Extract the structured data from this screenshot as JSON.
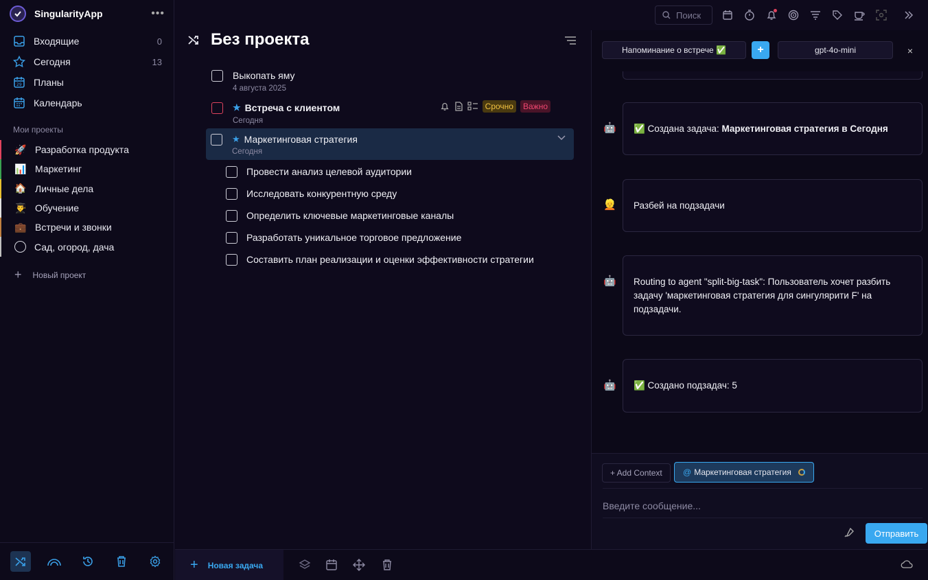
{
  "app": {
    "title": "SingularityApp",
    "menu": "•••"
  },
  "nav": [
    {
      "label": "Входящие",
      "count": "0"
    },
    {
      "label": "Сегодня",
      "count": "13"
    },
    {
      "label": "Планы",
      "count": ""
    },
    {
      "label": "Календарь",
      "count": ""
    }
  ],
  "projects_title": "Мои проекты",
  "projects": [
    {
      "emoji": "🚀",
      "label": "Разработка продукта",
      "color": "#e0435e"
    },
    {
      "emoji": "📊",
      "label": "Маркетинг",
      "color": "#3aa050"
    },
    {
      "emoji": "🏠",
      "label": "Личные дела",
      "color": "#e8c030"
    },
    {
      "emoji": "👨‍🎓",
      "label": "Обучение",
      "color": "#e0e0e0"
    },
    {
      "emoji": "💼",
      "label": "Встречи и звонки",
      "color": "#c08040"
    },
    {
      "emoji": "",
      "label": "Сад, огород, дача",
      "color": "#c0c0c0"
    }
  ],
  "new_project": "Новый проект",
  "main": {
    "title": "Без проекта",
    "tasks": [
      {
        "title": "Выкопать яму",
        "date": "4 августа 2025"
      },
      {
        "title": "Встреча с клиентом",
        "date": "Сегодня",
        "tag1": "Срочно",
        "tag2": "Важно"
      },
      {
        "title": "Маркетинговая стратегия",
        "date": "Сегодня"
      }
    ],
    "subtasks": [
      "Провести анализ целевой аудитории",
      "Исследовать конкурентную среду",
      "Определить ключевые маркетинговые каналы",
      "Разработать уникальное торговое предложение",
      "Составить план реализации и оценки эффективности стратегии"
    ]
  },
  "topbar": {
    "search_placeholder": "Поиск"
  },
  "chat": {
    "reminder": "Напоминание о встрече ✅",
    "model": "gpt-4o-mini",
    "close": "×",
    "messages": [
      {
        "avatar": "🤖",
        "prefix": "✅ Создана задача: ",
        "bold": "Маркетинговая стратегия в Сегодня"
      },
      {
        "avatar": "👱",
        "text": "Разбей на подзадачи"
      },
      {
        "avatar": "🤖",
        "text": "Routing to agent \"split-big-task\": Пользователь хочет разбить задачу 'маркетинговая стратегия для сингулярити F' на подзадачи."
      },
      {
        "avatar": "🤖",
        "text": "✅ Создано подзадач: 5"
      }
    ],
    "add_context": "+ Add Context",
    "context_chip": "Маркетинговая стратегия",
    "context_at": "@",
    "input_placeholder": "Введите сообщение...",
    "send": "Отправить"
  },
  "bottom": {
    "new_task": "Новая задача"
  },
  "colors": {
    "accent": "#39a8f0",
    "urgent": "#f0c040",
    "important": "#f04670"
  }
}
